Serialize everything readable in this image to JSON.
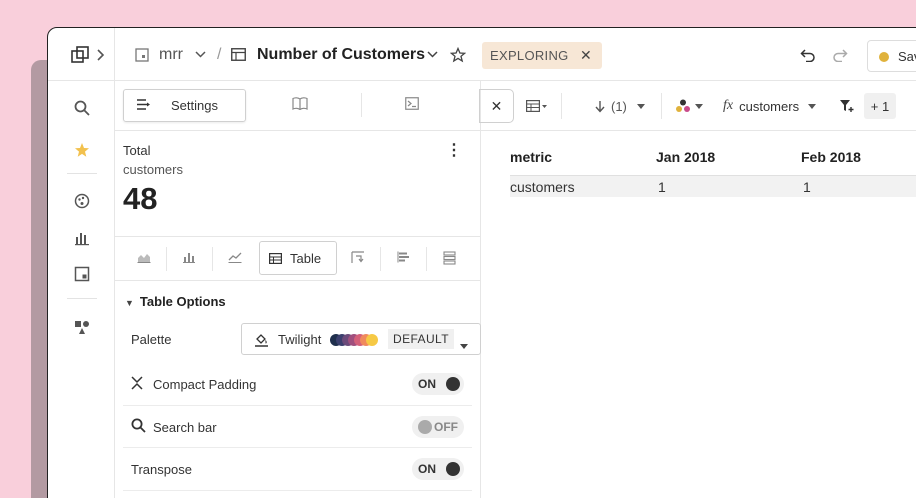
{
  "header": {
    "model_name": "mrr",
    "separator": "/",
    "title": "Number of Customers",
    "mode_badge": "EXPLORING",
    "save_label": "Sav"
  },
  "panel": {
    "settings_label": "Settings",
    "total": {
      "label": "Total",
      "sublabel": "customers",
      "value": "48"
    },
    "viz_tabs": {
      "active_label": "Table"
    },
    "table_options": {
      "heading": "Table Options",
      "palette_label": "Palette",
      "palette_name": "Twilight",
      "palette_badge": "DEFAULT",
      "palette_colors": [
        "#1f2f4d",
        "#3b3f6e",
        "#6b4a7a",
        "#a04f7e",
        "#d4607a",
        "#f08a5d",
        "#f6c945"
      ],
      "options": [
        {
          "label": "Compact Padding",
          "state": "ON",
          "icon": "compress-icon"
        },
        {
          "label": "Search bar",
          "state": "OFF",
          "icon": "search-icon"
        },
        {
          "label": "Transpose",
          "state": "ON",
          "icon": ""
        }
      ]
    }
  },
  "toolbar": {
    "sort_label": "(1)",
    "formula_label": "customers",
    "filter_extra": "+ 1"
  },
  "table": {
    "columns": [
      "metric",
      "Jan 2018",
      "Feb 2018"
    ],
    "rows": [
      [
        "customers",
        "1",
        "1"
      ]
    ]
  }
}
